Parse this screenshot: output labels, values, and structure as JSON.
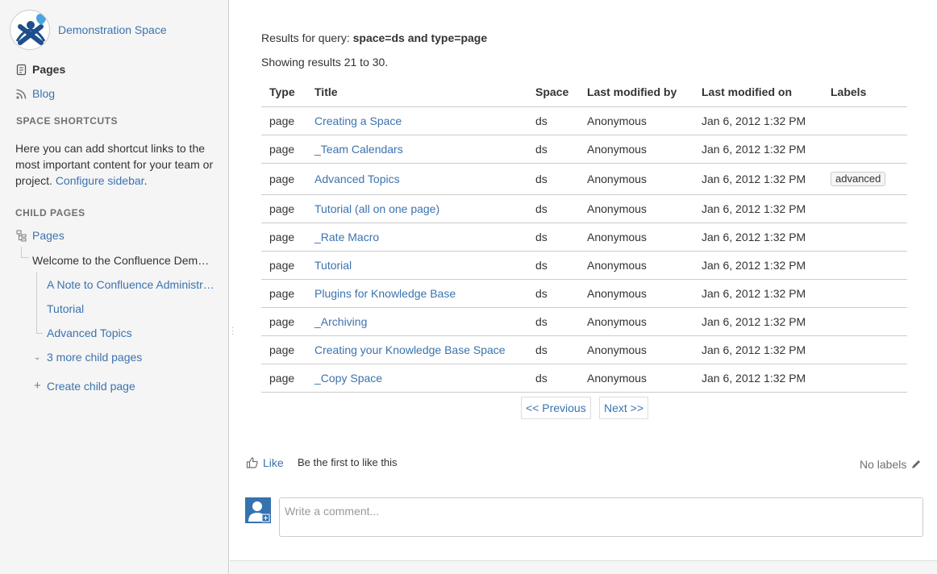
{
  "sidebar": {
    "space_name": "Demonstration Space",
    "nav": {
      "pages": "Pages",
      "blog": "Blog"
    },
    "shortcuts_heading": "SPACE SHORTCUTS",
    "shortcuts_text": "Here you can add shortcut links to the most important content for your team or project.",
    "configure_link": "Configure sidebar",
    "children_heading": "CHILD PAGES",
    "tree": {
      "root": "Pages",
      "welcome": "Welcome to the Confluence Demonstration Space",
      "children": [
        "A Note to Confluence Administrators",
        "Tutorial",
        "Advanced Topics"
      ],
      "more": "3 more child pages",
      "create": "Create child page"
    }
  },
  "main": {
    "query_label": "Results for query:",
    "query_value": "space=ds and type=page",
    "showing": "Showing results 21 to 30.",
    "columns": [
      "Type",
      "Title",
      "Space",
      "Last modified by",
      "Last modified on",
      "Labels"
    ],
    "rows": [
      {
        "type": "page",
        "title": "Creating a Space",
        "space": "ds",
        "by": "Anonymous",
        "on": "Jan 6, 2012 1:32 PM",
        "label": ""
      },
      {
        "type": "page",
        "title": "_Team Calendars",
        "space": "ds",
        "by": "Anonymous",
        "on": "Jan 6, 2012 1:32 PM",
        "label": ""
      },
      {
        "type": "page",
        "title": "Advanced Topics",
        "space": "ds",
        "by": "Anonymous",
        "on": "Jan 6, 2012 1:32 PM",
        "label": "advanced"
      },
      {
        "type": "page",
        "title": "Tutorial (all on one page)",
        "space": "ds",
        "by": "Anonymous",
        "on": "Jan 6, 2012 1:32 PM",
        "label": ""
      },
      {
        "type": "page",
        "title": "_Rate Macro",
        "space": "ds",
        "by": "Anonymous",
        "on": "Jan 6, 2012 1:32 PM",
        "label": ""
      },
      {
        "type": "page",
        "title": "Tutorial",
        "space": "ds",
        "by": "Anonymous",
        "on": "Jan 6, 2012 1:32 PM",
        "label": ""
      },
      {
        "type": "page",
        "title": "Plugins for Knowledge Base",
        "space": "ds",
        "by": "Anonymous",
        "on": "Jan 6, 2012 1:32 PM",
        "label": ""
      },
      {
        "type": "page",
        "title": "_Archiving",
        "space": "ds",
        "by": "Anonymous",
        "on": "Jan 6, 2012 1:32 PM",
        "label": ""
      },
      {
        "type": "page",
        "title": "Creating your Knowledge Base Space",
        "space": "ds",
        "by": "Anonymous",
        "on": "Jan 6, 2012 1:32 PM",
        "label": ""
      },
      {
        "type": "page",
        "title": "_Copy Space",
        "space": "ds",
        "by": "Anonymous",
        "on": "Jan 6, 2012 1:32 PM",
        "label": ""
      }
    ],
    "pager": {
      "prev": "<< Previous",
      "next": "Next >>"
    },
    "like": "Like",
    "like_first": "Be the first to like this",
    "no_labels": "No labels",
    "comment_placeholder": "Write a comment..."
  },
  "colors": {
    "link": "#3b73af",
    "sidebar_bg": "#f5f5f5",
    "avatar": "#3572b0"
  }
}
